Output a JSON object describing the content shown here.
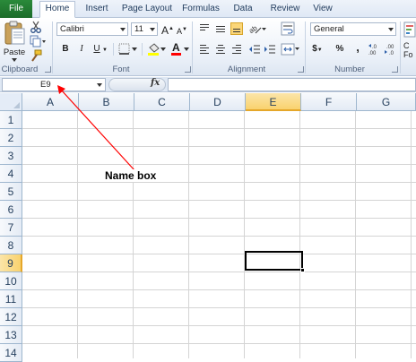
{
  "tabs": [
    {
      "label": "File"
    },
    {
      "label": "Home"
    },
    {
      "label": "Insert"
    },
    {
      "label": "Page Layout"
    },
    {
      "label": "Formulas"
    },
    {
      "label": "Data"
    },
    {
      "label": "Review"
    },
    {
      "label": "View"
    }
  ],
  "active_tab": "Home",
  "ribbon": {
    "clipboard": {
      "paste_label": "Paste",
      "group_label": "Clipboard"
    },
    "font": {
      "font_name": "Calibri",
      "font_size": "11",
      "bold": "B",
      "italic": "I",
      "underline": "U",
      "grow_font": "A",
      "shrink_font": "A",
      "font_color": "A",
      "group_label": "Font"
    },
    "alignment": {
      "group_label": "Alignment"
    },
    "number": {
      "format": "General",
      "currency": "$",
      "percent": "%",
      "comma": ",",
      "group_label": "Number"
    },
    "styles": {
      "truncated_label": "C\nFo"
    }
  },
  "formula_bar": {
    "name_box": "E9",
    "fx_label": "fx",
    "formula": ""
  },
  "grid": {
    "columns": [
      "A",
      "B",
      "C",
      "D",
      "E",
      "F",
      "G"
    ],
    "rows": [
      "1",
      "2",
      "3",
      "4",
      "5",
      "6",
      "7",
      "8",
      "9",
      "10",
      "11",
      "12",
      "13",
      "14"
    ],
    "selected_column": "E",
    "selected_row": "9",
    "active_cell": "E9"
  },
  "annotation": {
    "label": "Name box"
  },
  "colors": {
    "file_tab": "#1f7a2f",
    "selection_header": "#f9d26e",
    "annotation_arrow": "#ff0000"
  }
}
